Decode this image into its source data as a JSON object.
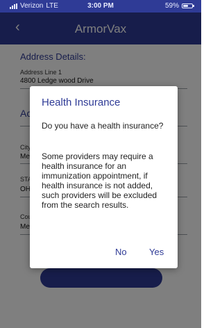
{
  "status_bar": {
    "carrier": "Verizon",
    "network": "LTE",
    "time": "3:00 PM",
    "battery": "59%",
    "battery_level": 0.59
  },
  "app_bar": {
    "back_icon": "chevron-left-icon",
    "title": "ArmorVax"
  },
  "form": {
    "address_section": {
      "heading": "Address Details:",
      "address_line1_label": "Address Line 1",
      "address_line1_value": "4800 Ledge wood Drive",
      "section2_heading_partial": "Ac",
      "city_label_partial": "City",
      "city_value_partial": "Me",
      "state_label_partial": "STA",
      "state_value_partial": "OH",
      "county_label_partial": "Cou",
      "county_value_partial": "Me"
    }
  },
  "dialog": {
    "title": "Health Insurance",
    "question": "Do you have a health insurance?",
    "body": "Some providers may require a health insurance for an immunization appointment, if health insurance is not added, such providers will be excluded from the search results.",
    "no_label": "No",
    "yes_label": "Yes"
  }
}
